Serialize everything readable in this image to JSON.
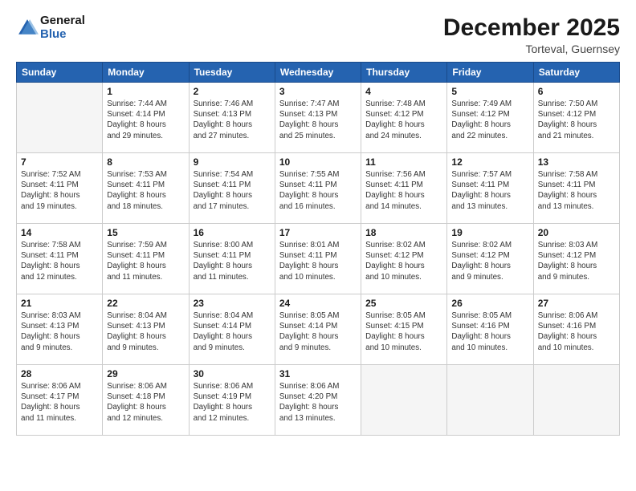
{
  "header": {
    "logo_line1": "General",
    "logo_line2": "Blue",
    "month": "December 2025",
    "location": "Torteval, Guernsey"
  },
  "weekdays": [
    "Sunday",
    "Monday",
    "Tuesday",
    "Wednesday",
    "Thursday",
    "Friday",
    "Saturday"
  ],
  "weeks": [
    [
      {
        "day": "",
        "info": ""
      },
      {
        "day": "1",
        "info": "Sunrise: 7:44 AM\nSunset: 4:14 PM\nDaylight: 8 hours\nand 29 minutes."
      },
      {
        "day": "2",
        "info": "Sunrise: 7:46 AM\nSunset: 4:13 PM\nDaylight: 8 hours\nand 27 minutes."
      },
      {
        "day": "3",
        "info": "Sunrise: 7:47 AM\nSunset: 4:13 PM\nDaylight: 8 hours\nand 25 minutes."
      },
      {
        "day": "4",
        "info": "Sunrise: 7:48 AM\nSunset: 4:12 PM\nDaylight: 8 hours\nand 24 minutes."
      },
      {
        "day": "5",
        "info": "Sunrise: 7:49 AM\nSunset: 4:12 PM\nDaylight: 8 hours\nand 22 minutes."
      },
      {
        "day": "6",
        "info": "Sunrise: 7:50 AM\nSunset: 4:12 PM\nDaylight: 8 hours\nand 21 minutes."
      }
    ],
    [
      {
        "day": "7",
        "info": "Sunrise: 7:52 AM\nSunset: 4:11 PM\nDaylight: 8 hours\nand 19 minutes."
      },
      {
        "day": "8",
        "info": "Sunrise: 7:53 AM\nSunset: 4:11 PM\nDaylight: 8 hours\nand 18 minutes."
      },
      {
        "day": "9",
        "info": "Sunrise: 7:54 AM\nSunset: 4:11 PM\nDaylight: 8 hours\nand 17 minutes."
      },
      {
        "day": "10",
        "info": "Sunrise: 7:55 AM\nSunset: 4:11 PM\nDaylight: 8 hours\nand 16 minutes."
      },
      {
        "day": "11",
        "info": "Sunrise: 7:56 AM\nSunset: 4:11 PM\nDaylight: 8 hours\nand 14 minutes."
      },
      {
        "day": "12",
        "info": "Sunrise: 7:57 AM\nSunset: 4:11 PM\nDaylight: 8 hours\nand 13 minutes."
      },
      {
        "day": "13",
        "info": "Sunrise: 7:58 AM\nSunset: 4:11 PM\nDaylight: 8 hours\nand 13 minutes."
      }
    ],
    [
      {
        "day": "14",
        "info": "Sunrise: 7:58 AM\nSunset: 4:11 PM\nDaylight: 8 hours\nand 12 minutes."
      },
      {
        "day": "15",
        "info": "Sunrise: 7:59 AM\nSunset: 4:11 PM\nDaylight: 8 hours\nand 11 minutes."
      },
      {
        "day": "16",
        "info": "Sunrise: 8:00 AM\nSunset: 4:11 PM\nDaylight: 8 hours\nand 11 minutes."
      },
      {
        "day": "17",
        "info": "Sunrise: 8:01 AM\nSunset: 4:11 PM\nDaylight: 8 hours\nand 10 minutes."
      },
      {
        "day": "18",
        "info": "Sunrise: 8:02 AM\nSunset: 4:12 PM\nDaylight: 8 hours\nand 10 minutes."
      },
      {
        "day": "19",
        "info": "Sunrise: 8:02 AM\nSunset: 4:12 PM\nDaylight: 8 hours\nand 9 minutes."
      },
      {
        "day": "20",
        "info": "Sunrise: 8:03 AM\nSunset: 4:12 PM\nDaylight: 8 hours\nand 9 minutes."
      }
    ],
    [
      {
        "day": "21",
        "info": "Sunrise: 8:03 AM\nSunset: 4:13 PM\nDaylight: 8 hours\nand 9 minutes."
      },
      {
        "day": "22",
        "info": "Sunrise: 8:04 AM\nSunset: 4:13 PM\nDaylight: 8 hours\nand 9 minutes."
      },
      {
        "day": "23",
        "info": "Sunrise: 8:04 AM\nSunset: 4:14 PM\nDaylight: 8 hours\nand 9 minutes."
      },
      {
        "day": "24",
        "info": "Sunrise: 8:05 AM\nSunset: 4:14 PM\nDaylight: 8 hours\nand 9 minutes."
      },
      {
        "day": "25",
        "info": "Sunrise: 8:05 AM\nSunset: 4:15 PM\nDaylight: 8 hours\nand 10 minutes."
      },
      {
        "day": "26",
        "info": "Sunrise: 8:05 AM\nSunset: 4:16 PM\nDaylight: 8 hours\nand 10 minutes."
      },
      {
        "day": "27",
        "info": "Sunrise: 8:06 AM\nSunset: 4:16 PM\nDaylight: 8 hours\nand 10 minutes."
      }
    ],
    [
      {
        "day": "28",
        "info": "Sunrise: 8:06 AM\nSunset: 4:17 PM\nDaylight: 8 hours\nand 11 minutes."
      },
      {
        "day": "29",
        "info": "Sunrise: 8:06 AM\nSunset: 4:18 PM\nDaylight: 8 hours\nand 12 minutes."
      },
      {
        "day": "30",
        "info": "Sunrise: 8:06 AM\nSunset: 4:19 PM\nDaylight: 8 hours\nand 12 minutes."
      },
      {
        "day": "31",
        "info": "Sunrise: 8:06 AM\nSunset: 4:20 PM\nDaylight: 8 hours\nand 13 minutes."
      },
      {
        "day": "",
        "info": ""
      },
      {
        "day": "",
        "info": ""
      },
      {
        "day": "",
        "info": ""
      }
    ]
  ]
}
